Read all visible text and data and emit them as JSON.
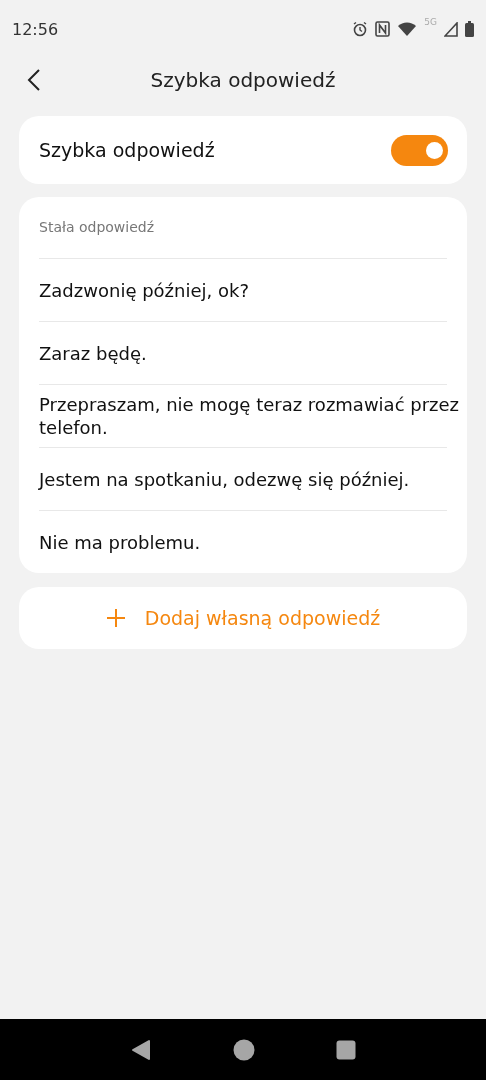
{
  "status_bar": {
    "time": "12:56",
    "network": "5G"
  },
  "header": {
    "title": "Szybka odpowiedź"
  },
  "toggle": {
    "label": "Szybka odpowiedź",
    "on": true
  },
  "replies": {
    "heading": "Stała odpowiedź",
    "items": [
      {
        "text": "Zadzwonię później, ok?"
      },
      {
        "text": "Zaraz będę."
      },
      {
        "text": "Przepraszam, nie mogę teraz rozmawiać przez telefon."
      },
      {
        "text": "Jestem na spotkaniu, odezwę się później."
      },
      {
        "text": "Nie ma problemu."
      }
    ]
  },
  "add_button": {
    "label": "Dodaj własną odpowiedź"
  }
}
